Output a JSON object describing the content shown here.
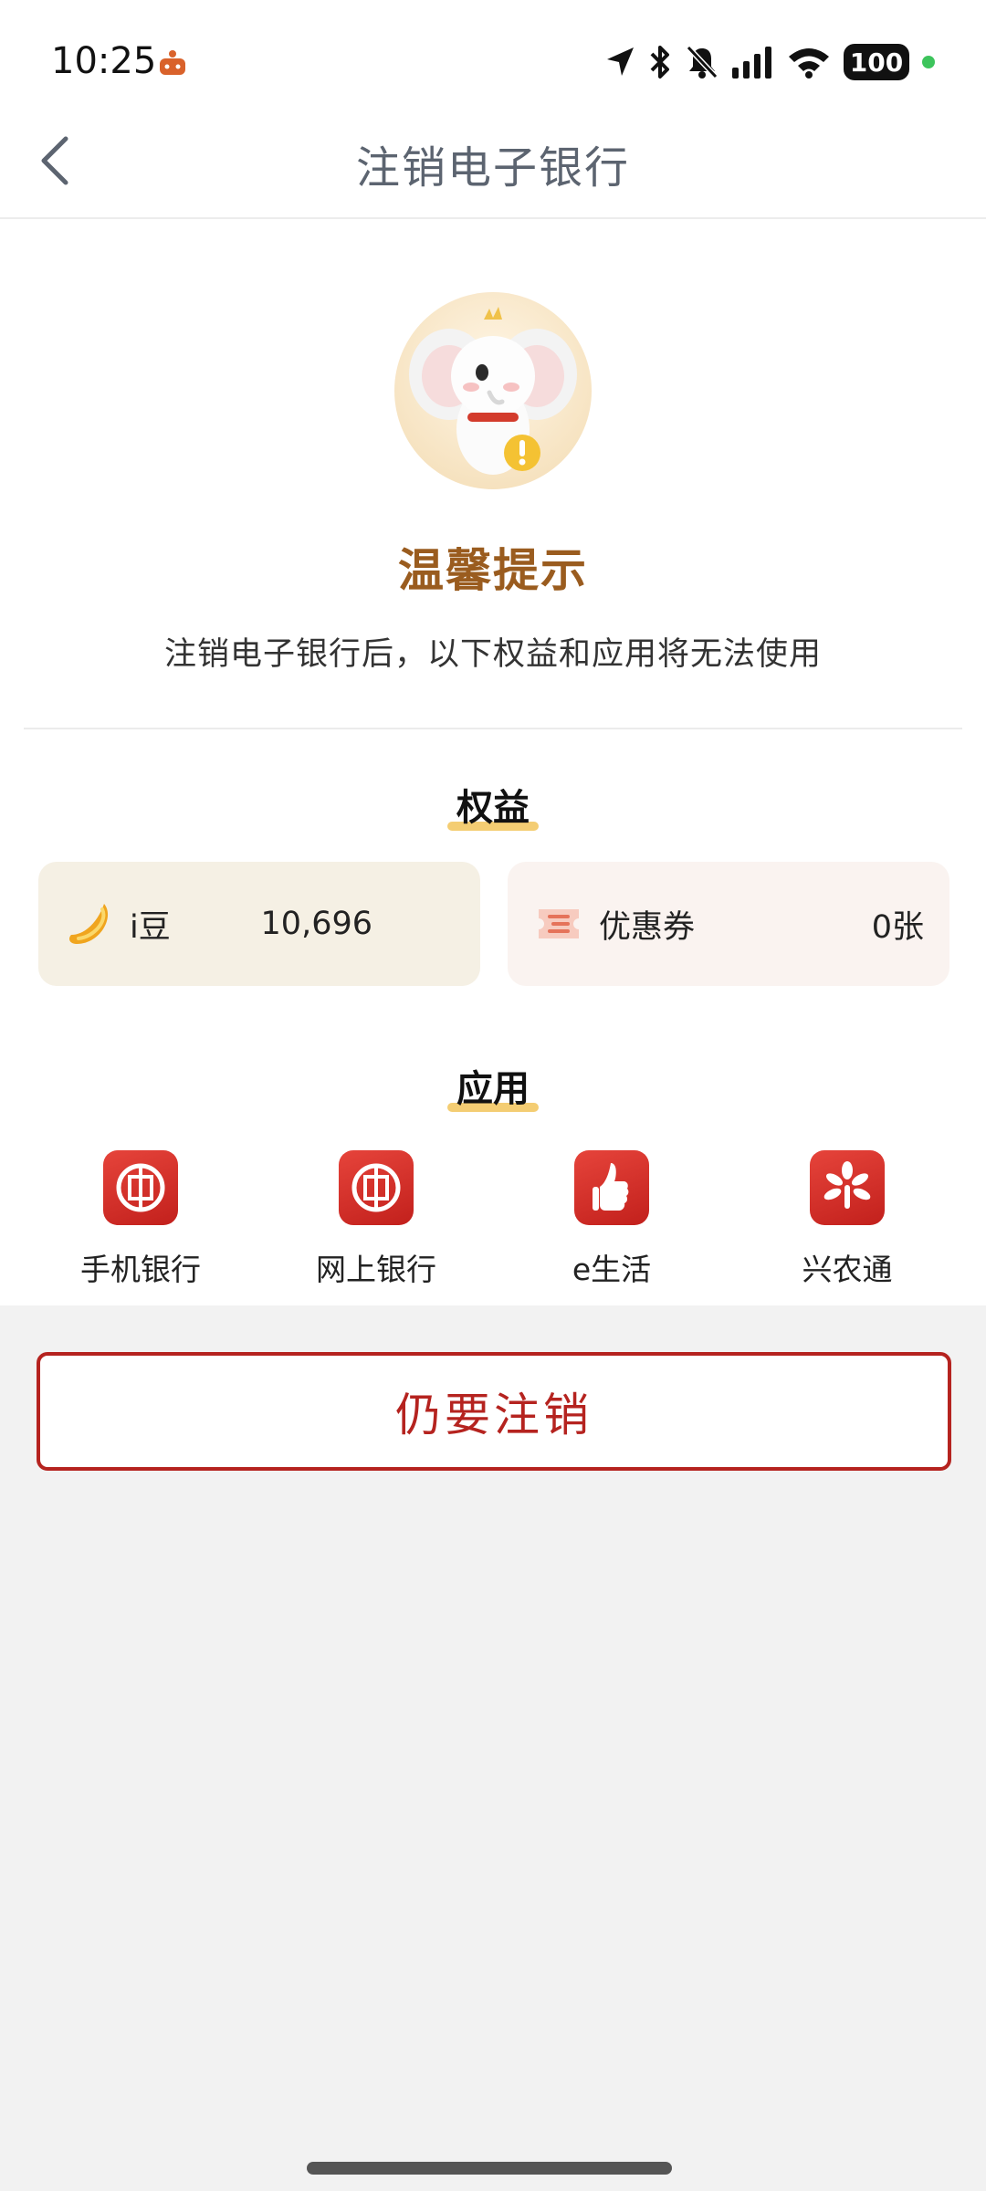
{
  "status_bar": {
    "time": "10:25",
    "battery": "100"
  },
  "nav": {
    "title": "注销电子银行"
  },
  "tip": {
    "title": "温馨提示",
    "description": "注销电子银行后，以下权益和应用将无法使用"
  },
  "rights": {
    "section_title": "权益",
    "items": [
      {
        "label": "i豆",
        "value": "10,696",
        "icon": "gold-bean-icon"
      },
      {
        "label": "优惠券",
        "value": "0张",
        "icon": "coupon-icon"
      }
    ]
  },
  "apps": {
    "section_title": "应用",
    "items": [
      {
        "label": "手机银行",
        "icon": "icbc-logo-icon"
      },
      {
        "label": "网上银行",
        "icon": "icbc-logo-icon"
      },
      {
        "label": "e生活",
        "icon": "thumbs-up-icon"
      },
      {
        "label": "兴农通",
        "icon": "flower-icon"
      }
    ]
  },
  "action": {
    "confirm_label": "仍要注销"
  },
  "colors": {
    "accent": "#b5231f",
    "tip_title": "#9a5c1f",
    "highlight": "#f4cd73"
  }
}
